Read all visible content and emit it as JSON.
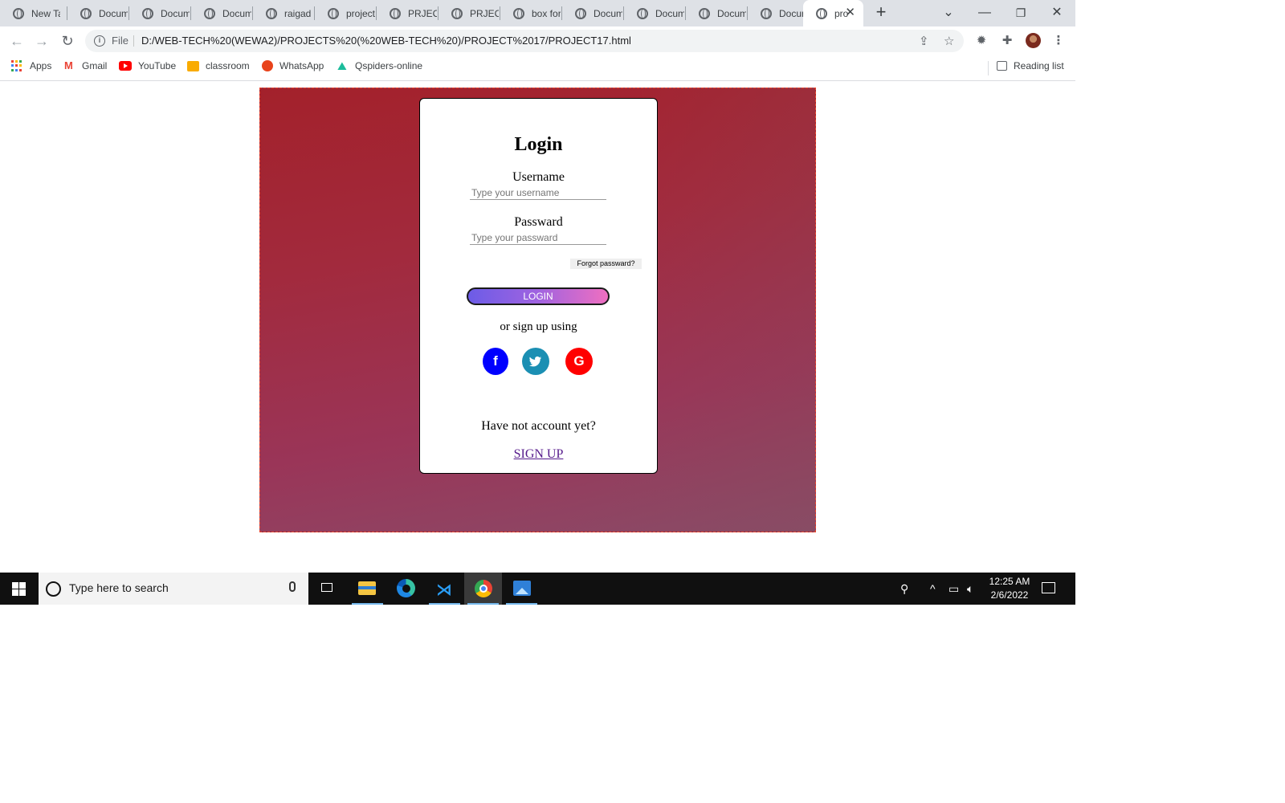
{
  "browser": {
    "tabs": [
      {
        "label": "New Ta"
      },
      {
        "label": "Docum"
      },
      {
        "label": "Docum"
      },
      {
        "label": "Docum"
      },
      {
        "label": "raigad"
      },
      {
        "label": "project"
      },
      {
        "label": "PRJECT"
      },
      {
        "label": "PRJECT"
      },
      {
        "label": "box for"
      },
      {
        "label": "Docum"
      },
      {
        "label": "Docum"
      },
      {
        "label": "Docum"
      },
      {
        "label": "Docum"
      }
    ],
    "active_tab": {
      "label": "pro"
    },
    "new_tab_label": "+",
    "address": {
      "scheme_label": "File",
      "url": "D:/WEB-TECH%20(WEWA2)/PROJECTS%20(%20WEB-TECH%20)/PROJECT%2017/PROJECT17.html"
    },
    "bookmarks": [
      {
        "label": "Apps",
        "icon": "apps-grid-icon"
      },
      {
        "label": "Gmail",
        "icon": "gmail-icon"
      },
      {
        "label": "YouTube",
        "icon": "youtube-icon"
      },
      {
        "label": "classroom",
        "icon": "classroom-icon"
      },
      {
        "label": "WhatsApp",
        "icon": "whatsapp-icon"
      },
      {
        "label": "Qspiders-online",
        "icon": "qspiders-icon"
      }
    ],
    "reading_list": "Reading list"
  },
  "login_card": {
    "title": "Login",
    "username_label": "Username",
    "username_placeholder": "Type your username",
    "password_label": "Passward",
    "password_placeholder": "Type your passward",
    "forgot_label": "Forgot passward?",
    "login_button": "LOGIN",
    "or_text": "or sign up using",
    "social": [
      {
        "name": "facebook",
        "glyph": "f",
        "color": "#0000ff"
      },
      {
        "name": "twitter",
        "glyph": "t",
        "color": "#1b8fb3"
      },
      {
        "name": "google",
        "glyph": "G",
        "color": "#ff0000"
      }
    ],
    "no_account_text": "Have not account yet?",
    "signup_link": "SIGN UP"
  },
  "taskbar": {
    "search_placeholder": "Type here to search",
    "apps": [
      {
        "name": "task-view-icon"
      },
      {
        "name": "file-explorer-icon"
      },
      {
        "name": "edge-icon"
      },
      {
        "name": "vscode-icon"
      },
      {
        "name": "chrome-icon"
      },
      {
        "name": "photos-icon"
      }
    ],
    "time": "12:25 AM",
    "date": "2/6/2022"
  },
  "colors": {
    "hero_top": "#a3212b",
    "hero_bottom": "#8a4b68",
    "login_gradient_start": "#6c5ce7",
    "login_gradient_end": "#ef6fc0",
    "link": "#551a8b"
  }
}
